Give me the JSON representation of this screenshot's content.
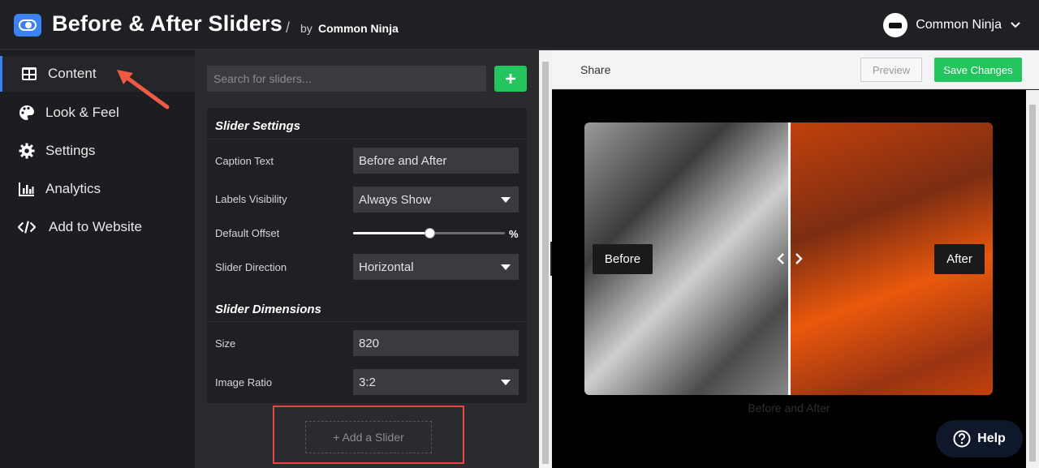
{
  "header": {
    "title": "Before & After Sliders",
    "separator": "/",
    "by": "by",
    "brand": "Common Ninja",
    "user_name": "Common Ninja"
  },
  "sidebar": {
    "items": [
      {
        "label": "Content",
        "icon": "table-icon",
        "active": true
      },
      {
        "label": "Look & Feel",
        "icon": "palette-icon"
      },
      {
        "label": "Settings",
        "icon": "gear-icon"
      },
      {
        "label": "Analytics",
        "icon": "bar-chart-icon"
      },
      {
        "label": "Add to Website",
        "icon": "code-icon"
      }
    ]
  },
  "panel": {
    "search_placeholder": "Search for sliders...",
    "slider_settings": {
      "title": "Slider Settings",
      "caption_label": "Caption Text",
      "caption_value": "Before and After",
      "labels_visibility_label": "Labels Visibility",
      "labels_visibility_value": "Always Show",
      "default_offset_label": "Default Offset",
      "default_offset_value": 50,
      "default_offset_unit": "%",
      "direction_label": "Slider Direction",
      "direction_value": "Horizontal"
    },
    "slider_dimensions": {
      "title": "Slider Dimensions",
      "size_label": "Size",
      "size_value": "820",
      "ratio_label": "Image Ratio",
      "ratio_value": "3:2"
    },
    "add_slider_label": "+ Add a Slider"
  },
  "preview": {
    "share_label": "Share",
    "preview_label": "Preview",
    "save_label": "Save Changes",
    "before_label": "Before",
    "after_label": "After",
    "caption": "Before and After",
    "help_label": "Help"
  },
  "colors": {
    "accent_green": "#22c55e",
    "accent_blue": "#3b82f6",
    "highlight_red": "#ef4444"
  }
}
